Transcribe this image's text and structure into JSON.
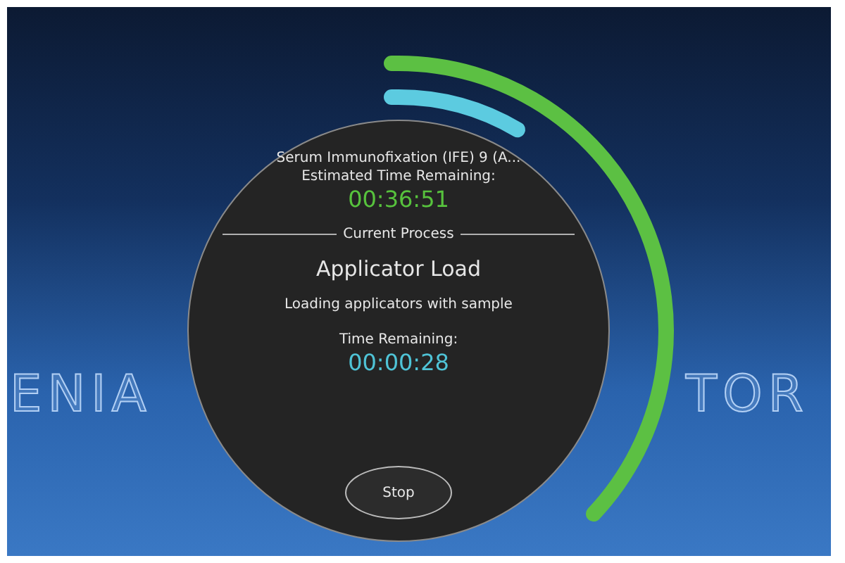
{
  "background_wordmark": {
    "left": "ENIA",
    "right": "TOR"
  },
  "run": {
    "test_name": "Serum Immunofixation (IFE) 9 (A...",
    "estimated_label": "Estimated Time Remaining:",
    "estimated_time": "00:36:51"
  },
  "current_process": {
    "heading": "Current Process",
    "name": "Applicator Load",
    "description": "Loading applicators with sample",
    "remaining_label": "Time Remaining:",
    "remaining_time": "00:00:28"
  },
  "buttons": [
    {
      "kind": "stop",
      "label": "Stop"
    }
  ]
}
